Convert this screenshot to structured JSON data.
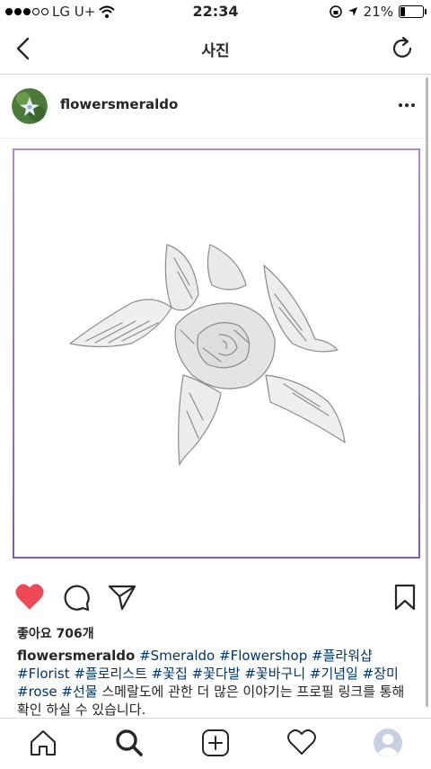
{
  "status_bar": {
    "carrier": "LG U+",
    "time": "22:34",
    "battery_percent": "21%",
    "battery_level": 0.21
  },
  "nav": {
    "title": "사진"
  },
  "post": {
    "username": "flowersmeraldo",
    "likes": "좋아요 706개",
    "caption_username": "flowersmeraldo",
    "caption_tags": "#Smeraldo #Flowershop #플라워샵 #Florist #플로리스트 #꽃집 #꽃다발 #꽃바구니 #기념일 #장미 #rose #선물",
    "caption_text": "스메랄도에 관한 더 많은 이야기는 프로필 링크를 통해 확인 하실 수 있습니다.",
    "liked": true
  },
  "colors": {
    "like_red": "#ed4956",
    "frame_purple": "#8a6cc8",
    "hashtag_blue": "#003569"
  },
  "icons": {
    "back": "chevron-left-icon",
    "refresh": "refresh-icon",
    "more": "more-icon",
    "like": "heart-icon",
    "comment": "comment-icon",
    "share": "send-icon",
    "save": "bookmark-icon",
    "home": "home-icon",
    "search": "search-icon",
    "add": "add-icon",
    "activity": "heart-outline-icon",
    "profile": "profile-icon"
  }
}
